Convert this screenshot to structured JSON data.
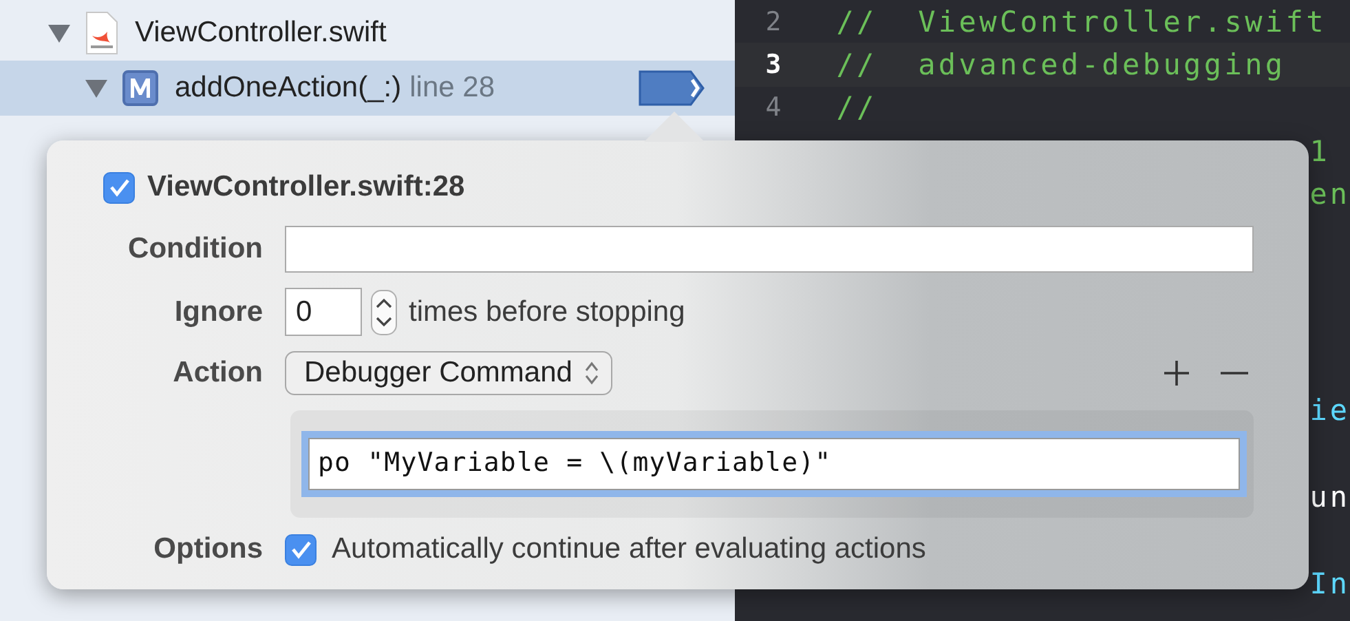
{
  "navigator": {
    "items": [
      {
        "kind": "file",
        "name": "ViewController.swift",
        "expanded": true,
        "selected": false
      },
      {
        "kind": "method",
        "name": "addOneAction(_:)",
        "detail": "line 28",
        "expanded": true,
        "selected": true,
        "breakpoint": {
          "enabled": true
        }
      }
    ]
  },
  "editor": {
    "lines": [
      {
        "number": "2",
        "text": "//  ViewController.swift",
        "kind": "comment",
        "current": false
      },
      {
        "number": "3",
        "text": "//  advanced-debugging",
        "kind": "comment",
        "current": true
      },
      {
        "number": "4",
        "text": "//",
        "kind": "comment",
        "current": false
      },
      {
        "tail": "1",
        "kind": "comment"
      },
      {
        "tail": "en",
        "kind": "comment"
      },
      {
        "tail": "ie",
        "kind": "type"
      },
      {
        "tail": "un",
        "kind": "plain"
      },
      {
        "tail": "In",
        "kind": "type"
      }
    ]
  },
  "breakpoint_popover": {
    "enabled": true,
    "title": "ViewController.swift:28",
    "condition": {
      "label": "Condition"
    },
    "ignore": {
      "label": "Ignore",
      "value": "0",
      "suffix": "times before stopping"
    },
    "action": {
      "label": "Action",
      "value": "Debugger Command",
      "command": "po \"MyVariable = \\(myVariable)\""
    },
    "options": {
      "label": "Options",
      "checked": true,
      "text": "Automatically continue after evaluating actions"
    }
  }
}
